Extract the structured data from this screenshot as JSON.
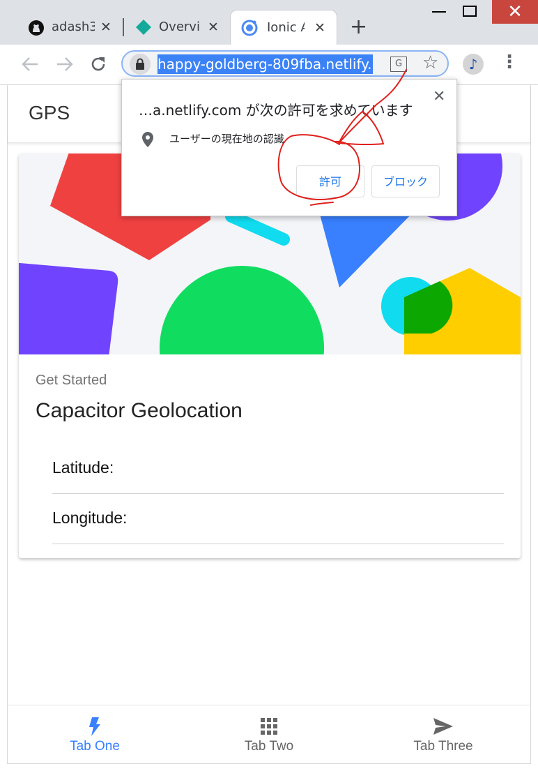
{
  "browser": {
    "tabs": [
      {
        "title": "adash3",
        "icon": "github-icon",
        "active": false
      },
      {
        "title": "Overvie",
        "icon": "diamond-icon",
        "active": false
      },
      {
        "title": "Ionic A",
        "icon": "ionic-icon",
        "active": true
      }
    ],
    "url": "happy-goldberg-809fba.netlify.",
    "close_glyph": "✕"
  },
  "permission_prompt": {
    "message": "…a.netlify.com が次の許可を求めています",
    "permission": "ユーザーの現在地の認識",
    "allow_label": "許可",
    "block_label": "ブロック"
  },
  "app": {
    "title": "GPS",
    "card": {
      "subtitle": "Get Started",
      "title": "Capacitor Geolocation",
      "latitude_label": "Latitude:",
      "longitude_label": "Longitude:"
    },
    "tabs": [
      {
        "label": "Tab One",
        "icon": "flash-icon",
        "selected": true
      },
      {
        "label": "Tab Two",
        "icon": "grid-icon",
        "selected": false
      },
      {
        "label": "Tab Three",
        "icon": "send-icon",
        "selected": false
      }
    ]
  },
  "colors": {
    "accent": "#3880ff",
    "selection": "#3b82f6",
    "annotation": "#e0201c",
    "tab_inactive": "#666666"
  }
}
